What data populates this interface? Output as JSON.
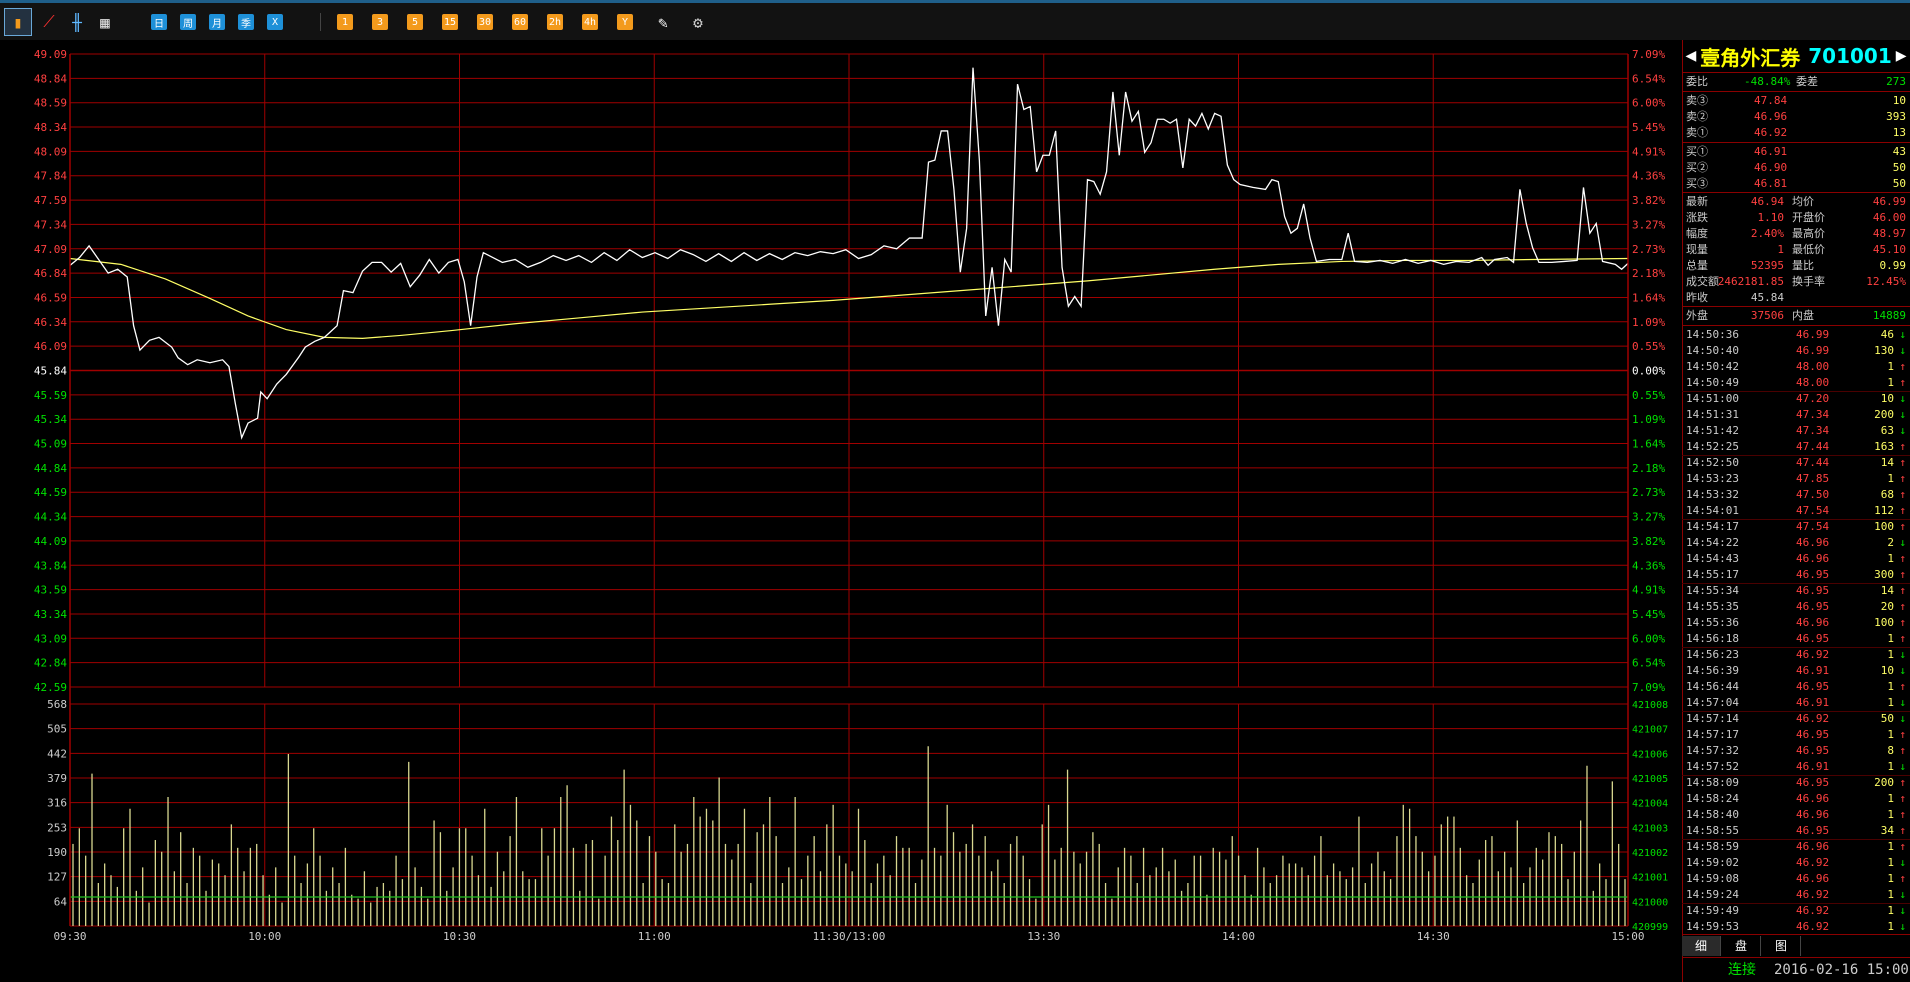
{
  "toolbar": {
    "icon_buttons": [
      "bar-chart-icon",
      "line-chart-icon",
      "candlestick-icon",
      "calendar-icon"
    ],
    "period_buttons": [
      "日",
      "周",
      "月",
      "季",
      "X"
    ],
    "minute_buttons": [
      "1",
      "3",
      "5",
      "15",
      "30",
      "60",
      "2h",
      "4h",
      "Y"
    ],
    "extra_icons": [
      "draw-tool-icon",
      "gear-icon"
    ]
  },
  "colors": {
    "up": "#ff4040",
    "down": "#00e000",
    "grid": "#a00000",
    "price_line": "#ffffff",
    "avg_line": "#ffff66",
    "volume": "#d8d890",
    "title": "#ffff00",
    "code": "#00ffff"
  },
  "chart_data": {
    "type": "line",
    "price_axis_left": [
      "49.09",
      "48.84",
      "48.59",
      "48.34",
      "48.09",
      "47.84",
      "47.59",
      "47.34",
      "47.09",
      "46.84",
      "46.59",
      "46.34",
      "46.09",
      "45.84",
      "45.59",
      "45.34",
      "45.09",
      "44.84",
      "44.59",
      "44.34",
      "44.09",
      "43.84",
      "43.59",
      "43.34",
      "43.09",
      "42.84",
      "42.59"
    ],
    "pct_axis_right": [
      "7.09%",
      "6.54%",
      "6.00%",
      "5.45%",
      "4.91%",
      "4.36%",
      "3.82%",
      "3.27%",
      "2.73%",
      "2.18%",
      "1.64%",
      "1.09%",
      "0.55%",
      "0.00%",
      "0.55%",
      "1.09%",
      "1.64%",
      "2.18%",
      "2.73%",
      "3.27%",
      "3.82%",
      "4.36%",
      "4.91%",
      "5.45%",
      "6.00%",
      "6.54%",
      "7.09%"
    ],
    "volume_axis_left": [
      "568",
      "505",
      "442",
      "379",
      "316",
      "253",
      "190",
      "127",
      "64"
    ],
    "volume_axis_right": [
      "421008",
      "421007",
      "421006",
      "421005",
      "421004",
      "421003",
      "421002",
      "421001",
      "421000",
      "420999"
    ],
    "time_labels": [
      "09:30",
      "10:00",
      "10:30",
      "11:00",
      "11:30/13:00",
      "13:30",
      "14:00",
      "14:30",
      "15:00"
    ],
    "prev_close": 45.84,
    "ylim": [
      42.59,
      49.09
    ],
    "price_series": [
      [
        0,
        46.92
      ],
      [
        1.5,
        47.0
      ],
      [
        3,
        47.12
      ],
      [
        4.5,
        46.98
      ],
      [
        6,
        46.84
      ],
      [
        7.5,
        46.88
      ],
      [
        9,
        46.8
      ],
      [
        10,
        46.3
      ],
      [
        11,
        46.05
      ],
      [
        12.5,
        46.15
      ],
      [
        14,
        46.18
      ],
      [
        16,
        46.08
      ],
      [
        17,
        45.97
      ],
      [
        18.5,
        45.9
      ],
      [
        20,
        45.95
      ],
      [
        22,
        45.92
      ],
      [
        24,
        45.95
      ],
      [
        25,
        45.88
      ],
      [
        26,
        45.5
      ],
      [
        27,
        45.15
      ],
      [
        28,
        45.3
      ],
      [
        29.5,
        45.35
      ],
      [
        30,
        45.62
      ],
      [
        31,
        45.55
      ],
      [
        32.5,
        45.7
      ],
      [
        34,
        45.8
      ],
      [
        36,
        45.98
      ],
      [
        37,
        46.08
      ],
      [
        38.5,
        46.14
      ],
      [
        40,
        46.18
      ],
      [
        42,
        46.3
      ],
      [
        43,
        46.66
      ],
      [
        44.5,
        46.64
      ],
      [
        46,
        46.86
      ],
      [
        47.5,
        46.95
      ],
      [
        49,
        46.95
      ],
      [
        50.5,
        46.85
      ],
      [
        52,
        46.94
      ],
      [
        53.5,
        46.7
      ],
      [
        55,
        46.82
      ],
      [
        56.5,
        46.98
      ],
      [
        58,
        46.84
      ],
      [
        59.5,
        46.95
      ],
      [
        61,
        46.98
      ],
      [
        62,
        46.75
      ],
      [
        63,
        46.3
      ],
      [
        64,
        46.8
      ],
      [
        65,
        47.05
      ],
      [
        66.5,
        47.0
      ],
      [
        68,
        46.95
      ],
      [
        70,
        46.98
      ],
      [
        72,
        46.9
      ],
      [
        74,
        46.95
      ],
      [
        76,
        47.02
      ],
      [
        78,
        46.97
      ],
      [
        80,
        47.02
      ],
      [
        82,
        46.95
      ],
      [
        84,
        47.05
      ],
      [
        86,
        46.97
      ],
      [
        88,
        47.08
      ],
      [
        90,
        47.0
      ],
      [
        92,
        47.05
      ],
      [
        94,
        46.99
      ],
      [
        96,
        47.08
      ],
      [
        98,
        47.03
      ],
      [
        100,
        46.96
      ],
      [
        102,
        47.04
      ],
      [
        104,
        46.96
      ],
      [
        106,
        47.05
      ],
      [
        108,
        46.97
      ],
      [
        110,
        47.04
      ],
      [
        112,
        46.98
      ],
      [
        114,
        47.05
      ],
      [
        116,
        47.02
      ],
      [
        118,
        47.06
      ],
      [
        120,
        47.04
      ],
      [
        122,
        47.08
      ],
      [
        124,
        46.99
      ],
      [
        126,
        47.03
      ],
      [
        128,
        47.12
      ],
      [
        130,
        47.09
      ],
      [
        132,
        47.2
      ],
      [
        134,
        47.2
      ],
      [
        135,
        47.98
      ],
      [
        136,
        48.0
      ],
      [
        137,
        48.3
      ],
      [
        138,
        48.3
      ],
      [
        139,
        47.7
      ],
      [
        140,
        46.85
      ],
      [
        141,
        47.3
      ],
      [
        142,
        48.95
      ],
      [
        143,
        48.0
      ],
      [
        144,
        46.4
      ],
      [
        145,
        46.9
      ],
      [
        146,
        46.3
      ],
      [
        147,
        46.98
      ],
      [
        148,
        46.85
      ],
      [
        149,
        48.78
      ],
      [
        150,
        48.52
      ],
      [
        151,
        48.55
      ],
      [
        152,
        47.88
      ],
      [
        153,
        48.05
      ],
      [
        154,
        48.05
      ],
      [
        155,
        48.3
      ],
      [
        156,
        46.9
      ],
      [
        157,
        46.5
      ],
      [
        158,
        46.6
      ],
      [
        159,
        46.5
      ],
      [
        160,
        47.8
      ],
      [
        161,
        47.78
      ],
      [
        162,
        47.65
      ],
      [
        163,
        47.88
      ],
      [
        164,
        48.7
      ],
      [
        165,
        48.05
      ],
      [
        166,
        48.7
      ],
      [
        167,
        48.4
      ],
      [
        168,
        48.5
      ],
      [
        169,
        48.08
      ],
      [
        170,
        48.18
      ],
      [
        171,
        48.42
      ],
      [
        172,
        48.42
      ],
      [
        173,
        48.38
      ],
      [
        174,
        48.42
      ],
      [
        175,
        47.92
      ],
      [
        176,
        48.42
      ],
      [
        177,
        48.35
      ],
      [
        178,
        48.48
      ],
      [
        179,
        48.32
      ],
      [
        180,
        48.48
      ],
      [
        181,
        48.45
      ],
      [
        182,
        47.95
      ],
      [
        183,
        47.8
      ],
      [
        184,
        47.75
      ],
      [
        186,
        47.72
      ],
      [
        188,
        47.7
      ],
      [
        189,
        47.8
      ],
      [
        190,
        47.78
      ],
      [
        191,
        47.42
      ],
      [
        192,
        47.25
      ],
      [
        193,
        47.3
      ],
      [
        194,
        47.55
      ],
      [
        195,
        47.2
      ],
      [
        196,
        46.96
      ],
      [
        198,
        46.98
      ],
      [
        200,
        46.98
      ],
      [
        201,
        47.25
      ],
      [
        202,
        46.96
      ],
      [
        204,
        46.95
      ],
      [
        206,
        46.97
      ],
      [
        208,
        46.94
      ],
      [
        210,
        46.98
      ],
      [
        212,
        46.94
      ],
      [
        214,
        46.97
      ],
      [
        216,
        46.93
      ],
      [
        218,
        46.96
      ],
      [
        220,
        46.95
      ],
      [
        222,
        47.0
      ],
      [
        223,
        46.92
      ],
      [
        224,
        46.98
      ],
      [
        226,
        47.0
      ],
      [
        227,
        46.95
      ],
      [
        228,
        47.7
      ],
      [
        229,
        47.35
      ],
      [
        230,
        47.1
      ],
      [
        231,
        46.95
      ],
      [
        233,
        46.95
      ],
      [
        235,
        46.96
      ],
      [
        237,
        46.97
      ],
      [
        238,
        47.72
      ],
      [
        239,
        47.25
      ],
      [
        240,
        47.35
      ],
      [
        241,
        46.96
      ],
      [
        243,
        46.93
      ],
      [
        244,
        46.88
      ],
      [
        245,
        46.94
      ]
    ],
    "avg_series": [
      [
        0,
        46.99
      ],
      [
        8,
        46.93
      ],
      [
        15,
        46.78
      ],
      [
        22,
        46.58
      ],
      [
        28,
        46.4
      ],
      [
        34,
        46.26
      ],
      [
        40,
        46.18
      ],
      [
        46,
        46.17
      ],
      [
        52,
        46.2
      ],
      [
        60,
        46.25
      ],
      [
        70,
        46.32
      ],
      [
        80,
        46.38
      ],
      [
        90,
        46.44
      ],
      [
        100,
        46.48
      ],
      [
        110,
        46.52
      ],
      [
        120,
        46.56
      ],
      [
        130,
        46.61
      ],
      [
        140,
        46.66
      ],
      [
        150,
        46.71
      ],
      [
        160,
        46.76
      ],
      [
        170,
        46.82
      ],
      [
        180,
        46.88
      ],
      [
        190,
        46.93
      ],
      [
        200,
        46.96
      ],
      [
        210,
        46.97
      ],
      [
        220,
        46.97
      ],
      [
        230,
        46.98
      ],
      [
        245,
        46.99
      ]
    ],
    "volume_series": [
      210,
      250,
      180,
      390,
      110,
      160,
      130,
      100,
      250,
      300,
      90,
      150,
      60,
      220,
      190,
      330,
      140,
      240,
      110,
      200,
      180,
      90,
      170,
      160,
      130,
      260,
      200,
      140,
      200,
      210,
      130,
      80,
      150,
      60,
      440,
      180,
      110,
      160,
      250,
      180,
      90,
      150,
      110,
      200,
      80,
      70,
      140,
      60,
      100,
      110,
      90,
      180,
      120,
      420,
      150,
      100,
      70,
      270,
      240,
      90,
      150,
      250,
      250,
      180,
      130,
      300,
      100,
      190,
      140,
      230,
      330,
      140,
      120,
      120,
      250,
      180,
      250,
      330,
      360,
      200,
      90,
      210,
      220,
      70,
      180,
      280,
      220,
      400,
      310,
      270,
      110,
      230,
      190,
      120,
      110,
      260,
      190,
      210,
      330,
      280,
      300,
      270,
      380,
      210,
      170,
      210,
      300,
      110,
      240,
      260,
      330,
      230,
      110,
      150,
      330,
      120,
      180,
      230,
      140,
      260,
      310,
      180,
      160,
      140,
      300,
      220,
      110,
      160,
      180,
      130,
      230,
      200,
      200,
      110,
      170,
      460,
      200,
      180,
      310,
      240,
      190,
      210,
      260,
      180,
      230,
      140,
      170,
      110,
      210,
      230,
      180,
      120,
      70,
      260,
      310,
      170,
      200,
      400,
      190,
      160,
      190,
      240,
      210,
      110,
      70,
      150,
      200,
      180,
      110,
      200,
      130,
      150,
      200,
      140,
      170,
      90,
      110,
      180,
      180,
      80,
      200,
      190,
      170,
      230,
      180,
      130,
      80,
      200,
      150,
      110,
      130,
      180,
      160,
      160,
      150,
      130,
      180,
      230,
      130,
      160,
      140,
      120,
      150,
      280,
      110,
      160,
      190,
      140,
      120,
      230,
      310,
      300,
      230,
      190,
      140,
      180,
      260,
      280,
      280,
      200,
      130,
      110,
      170,
      220,
      230,
      140,
      190,
      150,
      270,
      110,
      150,
      200,
      170,
      240,
      230,
      210,
      120,
      190,
      270,
      410,
      90,
      160,
      120,
      370,
      210,
      120
    ]
  },
  "panel": {
    "title": "壹角外汇券",
    "code": "701001",
    "wb_label": "委比",
    "wb_value": "-48.84%",
    "wc_label": "委差",
    "wc_value": "273",
    "asks": [
      {
        "label": "卖③",
        "price": "47.84",
        "vol": "10"
      },
      {
        "label": "卖②",
        "price": "46.96",
        "vol": "393"
      },
      {
        "label": "卖①",
        "price": "46.92",
        "vol": "13"
      }
    ],
    "bids": [
      {
        "label": "买①",
        "price": "46.91",
        "vol": "43"
      },
      {
        "label": "买②",
        "price": "46.90",
        "vol": "50"
      },
      {
        "label": "买③",
        "price": "46.81",
        "vol": "50"
      }
    ],
    "stats": [
      {
        "l1": "最新",
        "v1": "46.94",
        "l2": "均价",
        "v2": "46.99"
      },
      {
        "l1": "涨跌",
        "v1": "1.10",
        "l2": "开盘价",
        "v2": "46.00"
      },
      {
        "l1": "幅度",
        "v1": "2.40%",
        "l2": "最高价",
        "v2": "48.97"
      },
      {
        "l1": "现量",
        "v1": "1",
        "l2": "最低价",
        "v2": "45.10"
      },
      {
        "l1": "总量",
        "v1": "52395",
        "l2": "量比",
        "v2": "0.99"
      },
      {
        "l1": "成交额",
        "v1": "2462181.85",
        "l2": "换手率",
        "v2": "12.45%"
      },
      {
        "l1": "昨收",
        "v1": "45.84",
        "l2": "",
        "v2": ""
      }
    ],
    "outer_label": "外盘",
    "outer_value": "37506",
    "inner_label": "内盘",
    "inner_value": "14889",
    "ticks": [
      {
        "t": "14:50:36",
        "p": "46.99",
        "v": "46",
        "d": "↓"
      },
      {
        "t": "14:50:40",
        "p": "46.99",
        "v": "130",
        "d": "↓"
      },
      {
        "t": "14:50:42",
        "p": "48.00",
        "v": "1",
        "d": "↑"
      },
      {
        "t": "14:50:49",
        "p": "48.00",
        "v": "1",
        "d": "↑"
      },
      {
        "t": "14:51:00",
        "p": "47.20",
        "v": "10",
        "d": "↓"
      },
      {
        "t": "14:51:31",
        "p": "47.34",
        "v": "200",
        "d": "↓"
      },
      {
        "t": "14:51:42",
        "p": "47.34",
        "v": "63",
        "d": "↓"
      },
      {
        "t": "14:52:25",
        "p": "47.44",
        "v": "163",
        "d": "↑"
      },
      {
        "t": "14:52:50",
        "p": "47.44",
        "v": "14",
        "d": "↑"
      },
      {
        "t": "14:53:23",
        "p": "47.85",
        "v": "1",
        "d": "↑"
      },
      {
        "t": "14:53:32",
        "p": "47.50",
        "v": "68",
        "d": "↑"
      },
      {
        "t": "14:54:01",
        "p": "47.54",
        "v": "112",
        "d": "↑"
      },
      {
        "t": "14:54:17",
        "p": "47.54",
        "v": "100",
        "d": "↑"
      },
      {
        "t": "14:54:22",
        "p": "46.96",
        "v": "2",
        "d": "↓"
      },
      {
        "t": "14:54:43",
        "p": "46.96",
        "v": "1",
        "d": "↑"
      },
      {
        "t": "14:55:17",
        "p": "46.95",
        "v": "300",
        "d": "↑"
      },
      {
        "t": "14:55:34",
        "p": "46.95",
        "v": "14",
        "d": "↑"
      },
      {
        "t": "14:55:35",
        "p": "46.95",
        "v": "20",
        "d": "↑"
      },
      {
        "t": "14:55:36",
        "p": "46.96",
        "v": "100",
        "d": "↑"
      },
      {
        "t": "14:56:18",
        "p": "46.95",
        "v": "1",
        "d": "↑"
      },
      {
        "t": "14:56:23",
        "p": "46.92",
        "v": "1",
        "d": "↓"
      },
      {
        "t": "14:56:39",
        "p": "46.91",
        "v": "10",
        "d": "↓"
      },
      {
        "t": "14:56:44",
        "p": "46.95",
        "v": "1",
        "d": "↑"
      },
      {
        "t": "14:57:04",
        "p": "46.91",
        "v": "1",
        "d": "↓"
      },
      {
        "t": "14:57:14",
        "p": "46.92",
        "v": "50",
        "d": "↓"
      },
      {
        "t": "14:57:17",
        "p": "46.95",
        "v": "1",
        "d": "↑"
      },
      {
        "t": "14:57:32",
        "p": "46.95",
        "v": "8",
        "d": "↑"
      },
      {
        "t": "14:57:52",
        "p": "46.91",
        "v": "1",
        "d": "↓"
      },
      {
        "t": "14:58:09",
        "p": "46.95",
        "v": "200",
        "d": "↑"
      },
      {
        "t": "14:58:24",
        "p": "46.96",
        "v": "1",
        "d": "↑"
      },
      {
        "t": "14:58:40",
        "p": "46.96",
        "v": "1",
        "d": "↑"
      },
      {
        "t": "14:58:55",
        "p": "46.95",
        "v": "34",
        "d": "↑"
      },
      {
        "t": "14:58:59",
        "p": "46.96",
        "v": "1",
        "d": "↑"
      },
      {
        "t": "14:59:02",
        "p": "46.92",
        "v": "1",
        "d": "↓"
      },
      {
        "t": "14:59:08",
        "p": "46.96",
        "v": "1",
        "d": "↑"
      },
      {
        "t": "14:59:24",
        "p": "46.92",
        "v": "1",
        "d": "↓"
      },
      {
        "t": "14:59:49",
        "p": "46.92",
        "v": "1",
        "d": "↓"
      },
      {
        "t": "14:59:53",
        "p": "46.92",
        "v": "1",
        "d": "↓"
      }
    ],
    "tabs": [
      "细",
      "盘",
      "图"
    ]
  },
  "status": {
    "connection": "连接",
    "datetime": "2016-02-16 15:00"
  }
}
